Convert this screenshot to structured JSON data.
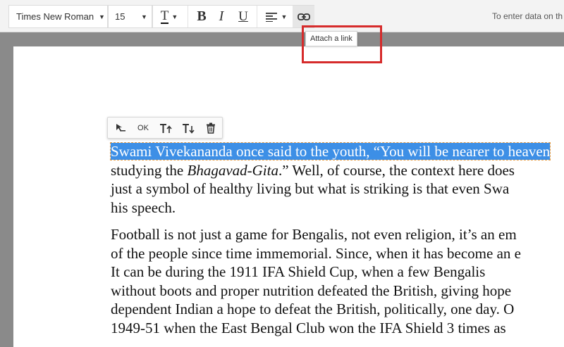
{
  "toolbar": {
    "font_family": "Times New Roman",
    "font_size": "15",
    "text_color_icon": "T",
    "bold": "B",
    "italic": "I",
    "underline": "U",
    "hint": "To enter data on th"
  },
  "tooltip": {
    "text": "Attach a link"
  },
  "mini_toolbar": {
    "ok_label": "OK"
  },
  "document": {
    "p1_l1": "Swami Vivekananda once said to the youth, “You will be nearer to heaven",
    "p1_l2a": "studying the ",
    "p1_l2b": "Bhagavad-Gita",
    "p1_l2c": ".” Well, of course, the context here does",
    "p1_l3": "just a symbol of healthy living but what is striking is that even Swa",
    "p1_l4": "his speech.",
    "p2_l1": "Football is not just a game for Bengalis, not even religion, it’s an em",
    "p2_l2": "of the people since time immemorial. Since, when it has become an e",
    "p2_l3": "It can be during the 1911 IFA Shield Cup, when a few Bengalis",
    "p2_l4": "without boots and proper nutrition defeated the British, giving hope",
    "p2_l5": "dependent Indian a hope to defeat the British, politically, one day. O",
    "p2_l6": "1949-51 when the East Bengal Club won the IFA Shield 3 times as"
  },
  "colors": {
    "selection": "#3d8fe6",
    "annotation": "#d62b2b"
  }
}
